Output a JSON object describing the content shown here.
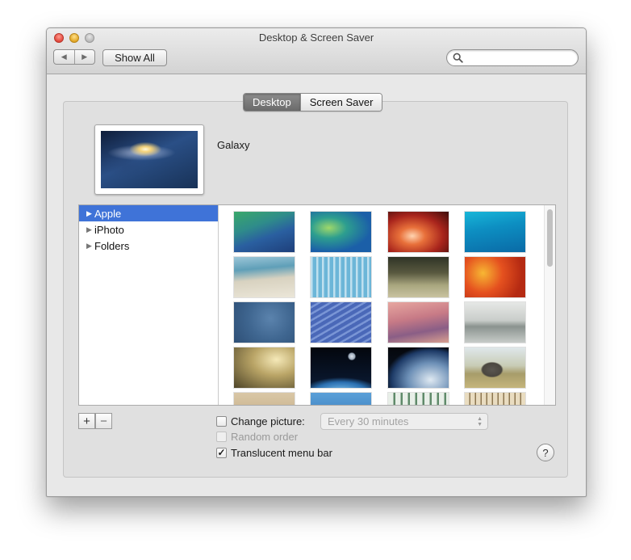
{
  "window": {
    "title": "Desktop & Screen Saver"
  },
  "toolbar": {
    "back_glyph": "◀",
    "forward_glyph": "▶",
    "show_all_label": "Show All",
    "search_placeholder": ""
  },
  "tabs": [
    {
      "label": "Desktop",
      "selected": true
    },
    {
      "label": "Screen Saver",
      "selected": false
    }
  ],
  "current_wallpaper": {
    "name": "Galaxy"
  },
  "sources": [
    {
      "label": "Apple",
      "selected": true,
      "glyph": "▶"
    },
    {
      "label": "iPhoto",
      "selected": false,
      "glyph": "▶"
    },
    {
      "label": "Folders",
      "selected": false,
      "glyph": "▶"
    }
  ],
  "wallpapers": [
    {
      "icon": "wave-green-blue"
    },
    {
      "icon": "aerial-green-algae"
    },
    {
      "icon": "red-canyon-rock"
    },
    {
      "icon": "turquoise-water"
    },
    {
      "icon": "beach-shore"
    },
    {
      "icon": "blue-forest-reflection"
    },
    {
      "icon": "grass-field"
    },
    {
      "icon": "orange-autumn-leaves"
    },
    {
      "icon": "blue-rain-ripples"
    },
    {
      "icon": "blue-sand-dunes"
    },
    {
      "icon": "pink-sunset-sand"
    },
    {
      "icon": "misty-lake"
    },
    {
      "icon": "cliff-bird-fog"
    },
    {
      "icon": "earth-moon-space"
    },
    {
      "icon": "earth-from-space"
    },
    {
      "icon": "elephant-savanna"
    },
    {
      "icon": "sand-partial"
    },
    {
      "icon": "water-partial"
    },
    {
      "icon": "leaves-partial"
    },
    {
      "icon": "savanna-partial"
    }
  ],
  "buttons": {
    "add": "+",
    "remove": "−",
    "help": "?"
  },
  "options": {
    "change_picture": {
      "label": "Change picture:",
      "checked": false
    },
    "interval": {
      "value": "Every 30 minutes",
      "enabled": false
    },
    "random_order": {
      "label": "Random order",
      "checked": false,
      "enabled": false
    },
    "translucent_menu_bar": {
      "label": "Translucent menu bar",
      "checked": true,
      "check_glyph": "✓"
    }
  },
  "colors": {
    "selection": "#3f73d8",
    "tab_active": "#7a7a7a"
  }
}
